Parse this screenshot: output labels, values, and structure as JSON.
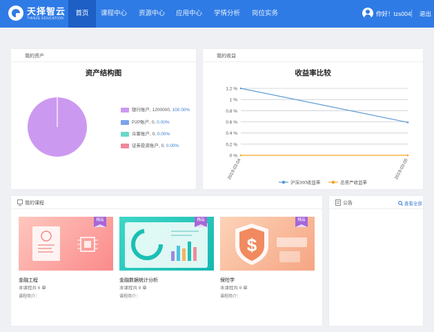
{
  "brand": {
    "name": "天择智云",
    "sub": "TIANZE EDUCATION"
  },
  "nav": [
    {
      "label": "首页",
      "active": true
    },
    {
      "label": "课程中心",
      "active": false
    },
    {
      "label": "资源中心",
      "active": false
    },
    {
      "label": "应用中心",
      "active": false
    },
    {
      "label": "学情分析",
      "active": false
    },
    {
      "label": "岗位实务",
      "active": false
    }
  ],
  "user": {
    "greeting": "你好！tzs004",
    "logout": "退出"
  },
  "assets": {
    "panel_label": "我的资产",
    "title": "资产结构图",
    "items": [
      {
        "name": "银行账户",
        "value": "1200000",
        "pct": "100.00%",
        "color": "#cc99f0"
      },
      {
        "name": "P2P账户",
        "value": "0",
        "pct": "0.00%",
        "color": "#7ba3ea"
      },
      {
        "name": "众筹账户",
        "value": "0",
        "pct": "0.00%",
        "color": "#6ad8c8"
      },
      {
        "name": "证券投资账户",
        "value": "0",
        "pct": "0.00%",
        "color": "#f08a9a"
      }
    ]
  },
  "earnings": {
    "panel_label": "我的收益",
    "chart_data": {
      "type": "line",
      "title": "收益率比较",
      "x": [
        "2019-03-04",
        "2019-03-05"
      ],
      "y_ticks": [
        "0 %",
        "0.2 %",
        "0.4 %",
        "0.6 %",
        "0.8 %",
        "1 %",
        "1.2 %"
      ],
      "ylim": [
        0,
        1.2
      ],
      "grid": true,
      "legend": "bottom",
      "series": [
        {
          "name": "沪深300收益率",
          "values": [
            1.2,
            0.59
          ],
          "color": "#5b9bd5"
        },
        {
          "name": "总资产收益率",
          "values": [
            0,
            0
          ],
          "color": "#f5a623"
        }
      ]
    }
  },
  "courses": {
    "panel_label": "我的课程",
    "items": [
      {
        "name": "金融工程",
        "chapters": "本课程共 6 章",
        "intro": "课程简介：",
        "badge": "精品"
      },
      {
        "name": "金融数据统计分析",
        "chapters": "本课程共 8 章",
        "intro": "课程简介：",
        "badge": "精品"
      },
      {
        "name": "保险学",
        "chapters": "本课程共 6 章",
        "intro": "课程简介：",
        "badge": "精品"
      }
    ]
  },
  "notice": {
    "panel_label": "公告",
    "view_all": "查看全部"
  },
  "colors": {
    "primary": "#2f7be5",
    "nav_active": "#1d5fc4"
  }
}
